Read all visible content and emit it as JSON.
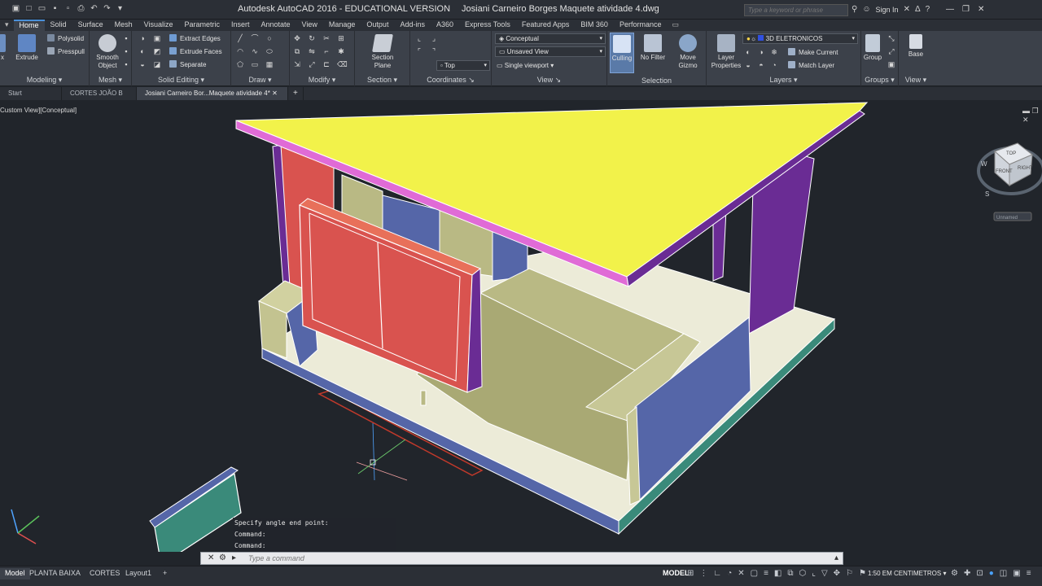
{
  "app": {
    "title": "Autodesk AutoCAD 2016 - EDUCATIONAL VERSION",
    "file": "Josiani Carneiro Borges Maquete atividade 4.dwg",
    "search_placeholder": "Type a keyword or phrase",
    "sign_in": "Sign In"
  },
  "ribbon_tabs": [
    "Home",
    "Solid",
    "Surface",
    "Mesh",
    "Visualize",
    "Parametric",
    "Insert",
    "Annotate",
    "View",
    "Manage",
    "Output",
    "Add-ins",
    "A360",
    "Express Tools",
    "Featured Apps",
    "BIM 360",
    "Performance"
  ],
  "ribbon": {
    "modeling": {
      "title": "Modeling",
      "extrude": "Extrude",
      "polysolid": "Polysolid",
      "presspull": "Presspull"
    },
    "mesh": {
      "title": "Mesh",
      "smooth_object": "Smooth Object"
    },
    "solid_editing": {
      "title": "Solid Editing",
      "extract_edges": "Extract Edges",
      "extrude_faces": "Extrude Faces",
      "separate": "Separate"
    },
    "draw": {
      "title": "Draw"
    },
    "modify": {
      "title": "Modify"
    },
    "section": {
      "title": "Section",
      "section_plane": "Section Plane"
    },
    "coordinates": {
      "title": "Coordinates",
      "top": "Top"
    },
    "view": {
      "title": "View",
      "visual_style": "Conceptual",
      "named_view": "Unsaved View",
      "viewport": "Single viewport"
    },
    "selection": {
      "title": "Selection",
      "culling": "Culling",
      "no_filter": "No Filter",
      "move_gizmo": "Move Gizmo"
    },
    "layers": {
      "title": "Layers",
      "layer_properties": "Layer Properties",
      "current_layer": "3D ELETRONICOS",
      "make_current": "Make Current",
      "match_layer": "Match Layer"
    },
    "groups": {
      "title": "Groups",
      "group": "Group"
    },
    "view2": {
      "title": "View",
      "base": "Base"
    }
  },
  "doc_tabs": [
    "Start",
    "CORTES JOÃO B",
    "Josiani Carneiro Bor...Maquete atividade 4*"
  ],
  "viewport": {
    "label": "Custom View][Conceptual]",
    "viewcube_top": "TOP",
    "viewcube_front": "FRONT",
    "viewcube_right": "RIGHT",
    "viewcube_w": "W",
    "viewcube_s": "S",
    "wcs_menu": "Unnamed"
  },
  "command": {
    "history": [
      "Specify angle end point:",
      "Command:",
      "Command:"
    ],
    "placeholder": "Type a command"
  },
  "status": {
    "layout_tabs": [
      "Model",
      "PLANTA BAIXA",
      "CORTES",
      "Layout1"
    ],
    "model": "MODEL",
    "scale": "1:50 EM CENTIMETROS"
  },
  "colors": {
    "roof": "#f2f24a",
    "wall_red": "#d9534f",
    "wall_purple": "#6a2c94",
    "furniture": "#b9b984",
    "floor": "#ecebd8",
    "blue": "#5566a8",
    "teal": "#3a8a7a"
  }
}
